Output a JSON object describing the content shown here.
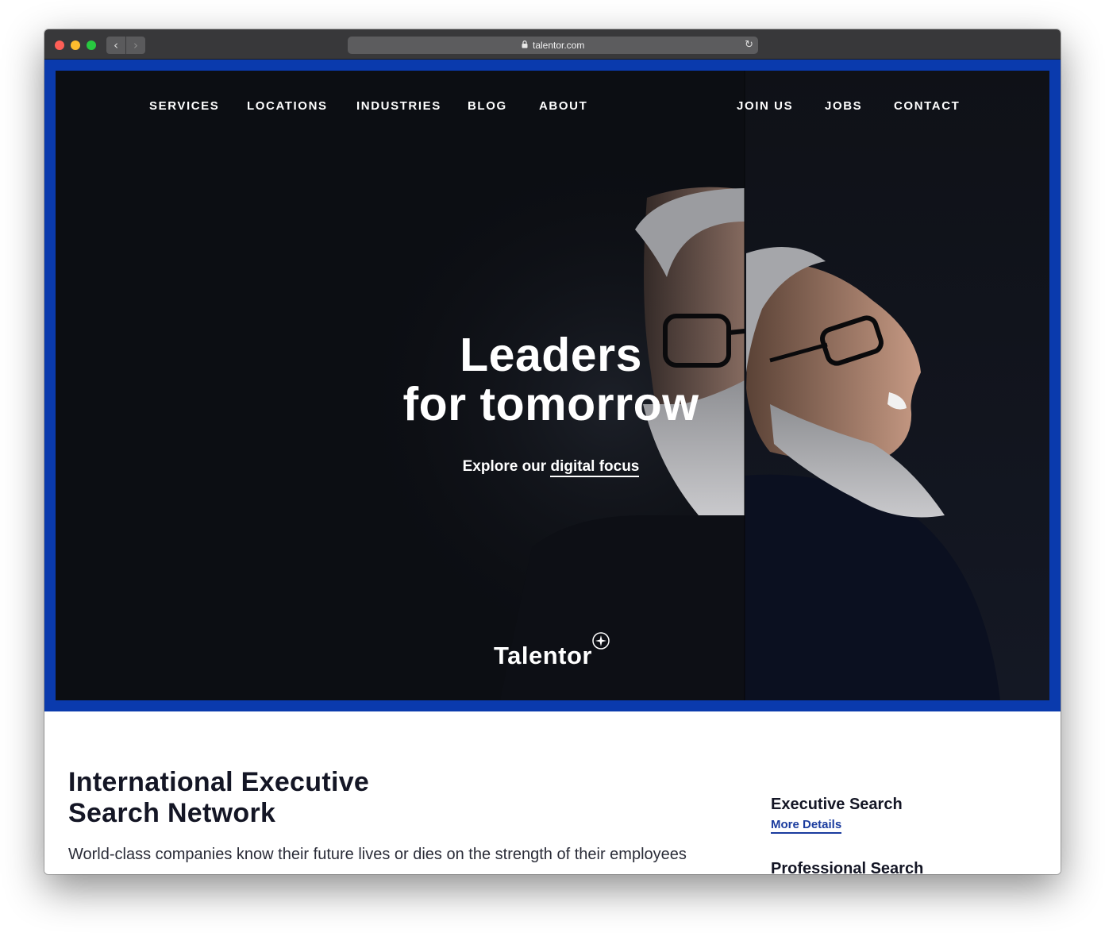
{
  "browser": {
    "url": "talentor.com",
    "back_icon": "‹",
    "forward_icon": "›",
    "lock_icon": "🔒",
    "reload_icon": "↻"
  },
  "nav": {
    "left": [
      "SERVICES",
      "LOCATIONS",
      "INDUSTRIES",
      "BLOG",
      "ABOUT"
    ],
    "right": [
      "JOIN US",
      "JOBS",
      "CONTACT"
    ]
  },
  "hero": {
    "headline_line1": "Leaders",
    "headline_line2": "for tomorrow",
    "explore_prefix": "Explore our",
    "explore_link": "digital focus",
    "logo": "Talentor"
  },
  "content": {
    "title_line1": "International Executive",
    "title_line2": "Search Network",
    "subtitle": "World-class companies know their future lives or dies on the strength of their employees",
    "services": [
      {
        "name": "Executive Search",
        "link": "More Details"
      },
      {
        "name": "Professional Search"
      }
    ]
  },
  "colors": {
    "brand_blue": "#0a3aad",
    "hero_bg": "#0c0e13",
    "link_blue": "#1b3c9e",
    "heading_dark": "#141625"
  }
}
